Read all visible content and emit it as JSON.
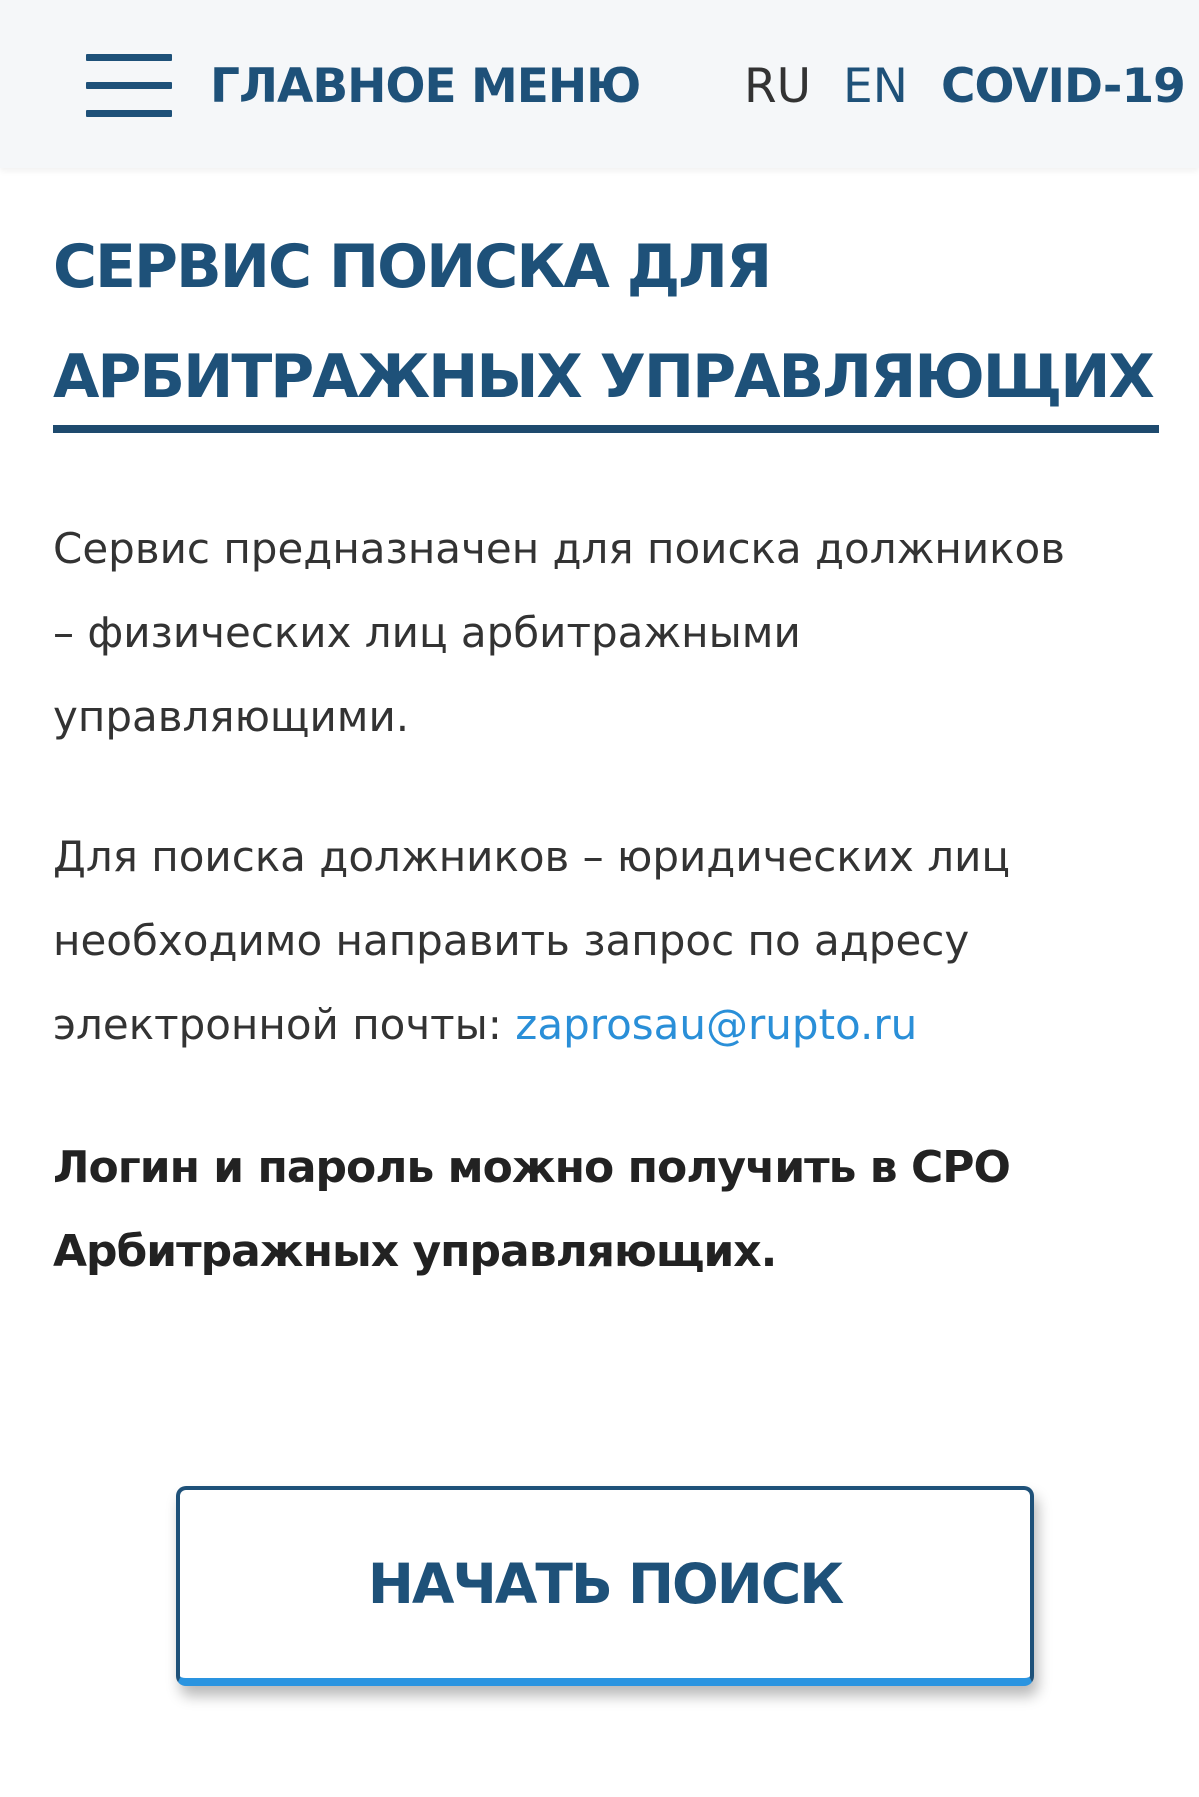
{
  "header": {
    "menu_label": "ГЛАВНОЕ МЕНЮ",
    "menu_icon": "hamburger-menu-icon",
    "languages": [
      {
        "code": "RU",
        "active": true
      },
      {
        "code": "EN",
        "active": false
      }
    ],
    "covid_link": "COVID-19"
  },
  "main": {
    "title_lines": [
      "СЕРВИС ПОИСКА ДЛЯ",
      "АРБИТРАЖНЫХ УПРАВЛЯЮЩИХ"
    ],
    "paragraph1_lines": [
      "Сервис предназначен для поиска должников",
      "– физических лиц арбитражными",
      "управляющими."
    ],
    "paragraph2_lines": [
      "Для поиска  должников – юридических лиц",
      "необходимо направить запрос по адресу",
      "электронной почты: "
    ],
    "email": "zaprosau@rupto.ru",
    "note_lines": [
      "Логин и пароль можно получить в СРО",
      "Арбитражных управляющих."
    ],
    "start_button_label": "НАЧАТЬ ПОИСК"
  },
  "colors": {
    "brand": "#1e5179",
    "link": "#2a8fd8",
    "text": "#333333",
    "header_bg": "#f5f7f9",
    "button_accent": "#2a94e0"
  }
}
